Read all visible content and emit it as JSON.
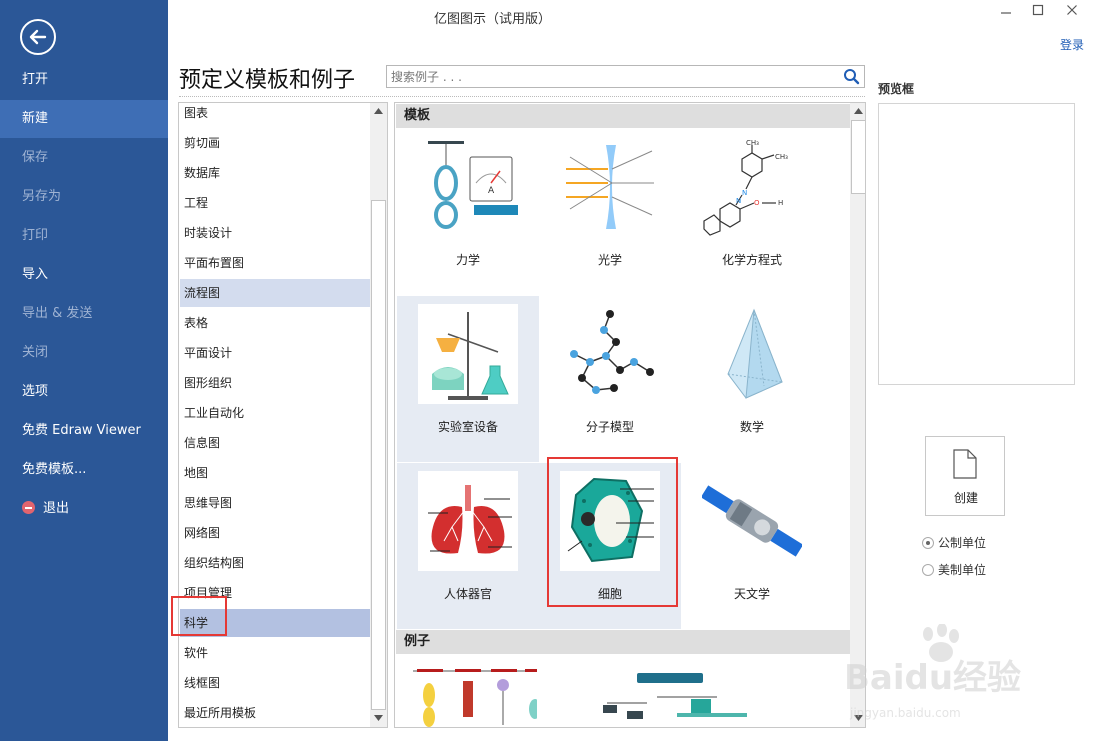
{
  "window": {
    "title": "亿图图示（试用版）",
    "login": "登录"
  },
  "sidebar": {
    "items": [
      {
        "label": "打开",
        "state": "normal"
      },
      {
        "label": "新建",
        "state": "active"
      },
      {
        "label": "保存",
        "state": "disabled"
      },
      {
        "label": "另存为",
        "state": "disabled"
      },
      {
        "label": "打印",
        "state": "disabled"
      },
      {
        "label": "导入",
        "state": "normal"
      },
      {
        "label": "导出 & 发送",
        "state": "disabled"
      },
      {
        "label": "关闭",
        "state": "disabled"
      },
      {
        "label": "选项",
        "state": "normal"
      },
      {
        "label": "免费 Edraw Viewer",
        "state": "normal"
      },
      {
        "label": "免费模板...",
        "state": "normal"
      },
      {
        "label": "退出",
        "state": "normal"
      }
    ]
  },
  "header": {
    "title": "预定义模板和例子",
    "search_placeholder": "搜索例子 . . ."
  },
  "categories": [
    "图表",
    "剪切画",
    "数据库",
    "工程",
    "时装设计",
    "平面布置图",
    "流程图",
    "表格",
    "平面设计",
    "图形组织",
    "工业自动化",
    "信息图",
    "地图",
    "思维导图",
    "网络图",
    "组织结构图",
    "项目管理",
    "科学",
    "软件",
    "线框图",
    "最近所用模板"
  ],
  "gallery": {
    "templates_header": "模板",
    "examples_header": "例子",
    "templates": [
      "力学",
      "光学",
      "化学方程式",
      "实验室设备",
      "分子模型",
      "数学",
      "人体器官",
      "细胞",
      "天文学"
    ]
  },
  "right_panel": {
    "preview_label": "预览框",
    "create_label": "创建",
    "units": [
      "公制单位",
      "美制单位"
    ]
  },
  "watermark": {
    "text": "Baidu经验",
    "url": "jingyan.baidu.com"
  },
  "colors": {
    "sidebar": "#2b5797",
    "sidebar_active": "#3e6eb5",
    "highlight": "#e53935"
  }
}
